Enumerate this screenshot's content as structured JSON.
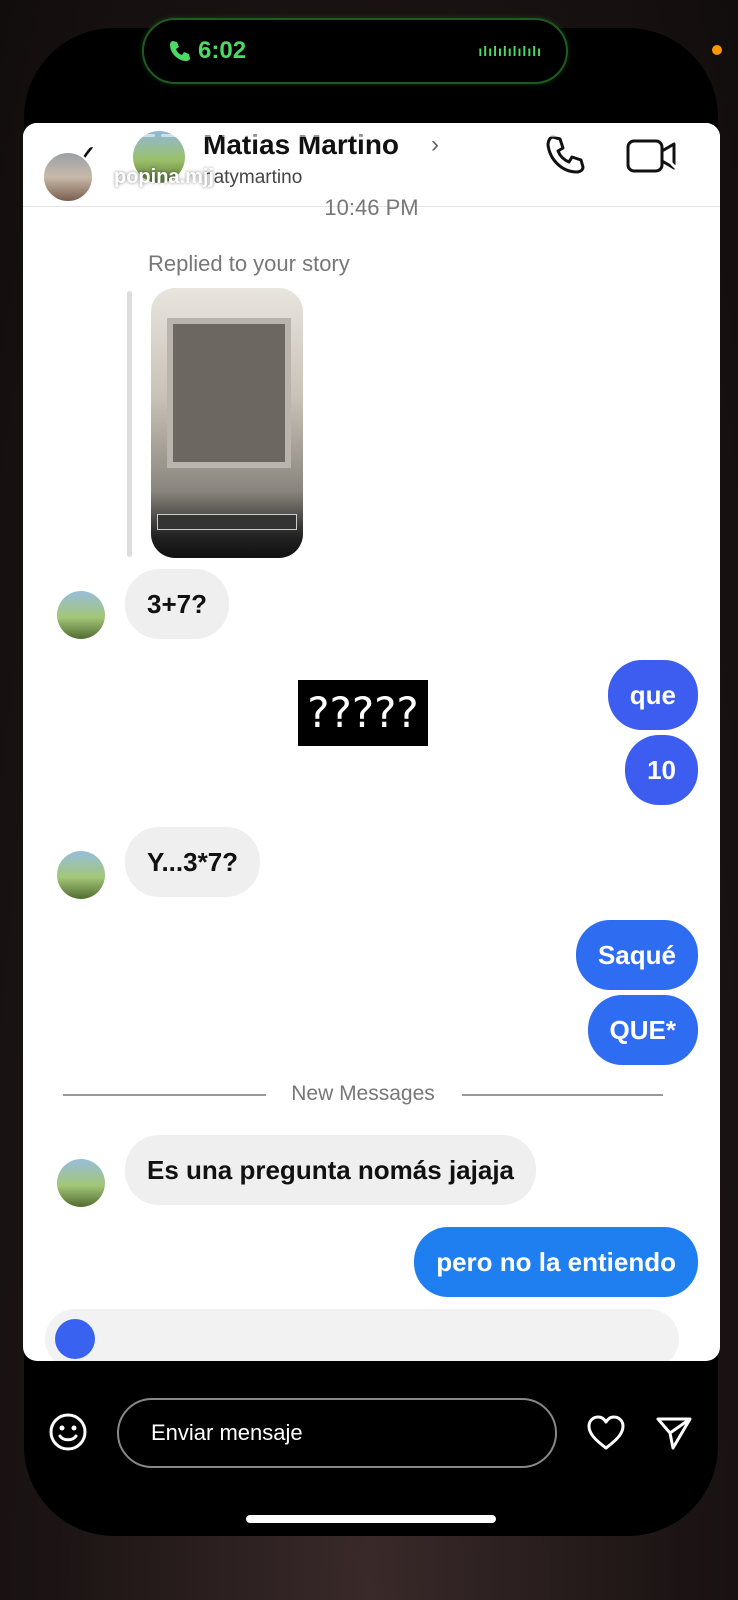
{
  "status_bar": {
    "time": "6:02"
  },
  "story": {
    "username": "popina.mjj",
    "close_icon": "close-icon",
    "more_icon": "more-dots-icon"
  },
  "chat": {
    "contact_name": "Matias Martino",
    "handle": "natymartino",
    "timestamp": "10:46 PM",
    "story_reply_label": "Replied to your story",
    "sticker_text": "?????",
    "new_messages_label": "New Messages",
    "messages": [
      {
        "from": "them",
        "text": "3+7?"
      },
      {
        "from": "me",
        "text": "que"
      },
      {
        "from": "me",
        "text": "10"
      },
      {
        "from": "them",
        "text": "Y...3*7?"
      },
      {
        "from": "me",
        "text": "Saqué"
      },
      {
        "from": "me",
        "text": "QUE*"
      },
      {
        "from": "them",
        "text": "Es una pregunta nomás jajaja"
      },
      {
        "from": "me",
        "text": "pero no la entiendo"
      }
    ],
    "colors": {
      "outgoing": "#3d5cf0",
      "incoming": "#efefef"
    }
  },
  "reply_bar": {
    "placeholder": "Enviar mensaje"
  }
}
